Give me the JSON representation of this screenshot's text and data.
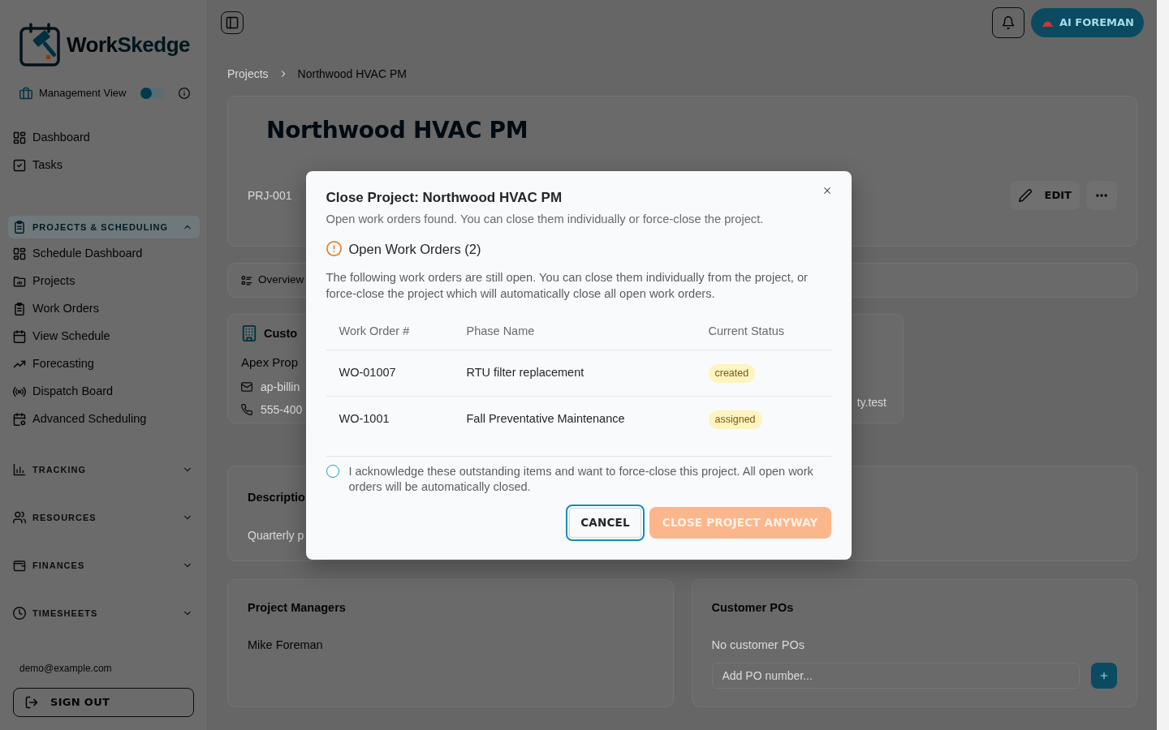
{
  "brand": {
    "first": "Work",
    "second": "Skedge"
  },
  "view_toggle": {
    "label": "Management View",
    "on": false
  },
  "sidebar": {
    "items": [
      {
        "label": "Dashboard",
        "selected": false
      },
      {
        "label": "Tasks",
        "selected": false
      }
    ],
    "sections": [
      {
        "label": "PROJECTS & SCHEDULING",
        "expanded": true,
        "items": [
          {
            "label": "Schedule Dashboard",
            "selected": false
          },
          {
            "label": "Projects",
            "selected": false
          },
          {
            "label": "Work Orders",
            "selected": false
          },
          {
            "label": "View Schedule",
            "selected": false
          },
          {
            "label": "Forecasting",
            "selected": false
          },
          {
            "label": "Dispatch Board",
            "selected": false
          },
          {
            "label": "Advanced Scheduling",
            "selected": false
          }
        ]
      },
      {
        "label": "TRACKING",
        "expanded": false
      },
      {
        "label": "RESOURCES",
        "expanded": false
      },
      {
        "label": "FINANCES",
        "expanded": false
      },
      {
        "label": "TIMESHEETS",
        "expanded": false
      }
    ],
    "user_email": "demo@example.com",
    "sign_out": "SIGN OUT"
  },
  "header": {
    "ai_button": "AI FOREMAN"
  },
  "breadcrumb": [
    {
      "label": "Projects",
      "current": false
    },
    {
      "label": "Northwood HVAC PM",
      "current": true
    }
  ],
  "project": {
    "title": "Northwood HVAC PM",
    "id": "PRJ-001",
    "edit_button": "EDIT"
  },
  "tabs": [
    {
      "label": "Overview",
      "selected": true
    }
  ],
  "customer": {
    "heading": "Custo",
    "name": "Apex Prop",
    "email": "ap-billin",
    "phone": "555-400"
  },
  "contact": {
    "text": "ty.test"
  },
  "description": {
    "heading": "Descriptio",
    "text": "Quarterly p"
  },
  "project_managers": {
    "heading": "Project Managers",
    "names": [
      "Mike Foreman"
    ]
  },
  "customer_pos": {
    "heading": "Customer POs",
    "empty_text": "No customer POs",
    "input": {
      "placeholder": "Add PO number..."
    }
  },
  "dialog": {
    "title": "Close Project: Northwood HVAC PM",
    "subtitle": "Open work orders found. You can close them individually or force-close the project.",
    "warning": {
      "heading": "Open Work Orders (2)",
      "text": "The following work orders are still open. You can close them individually from the project, or force-close the project which will automatically close all open work orders."
    },
    "table": {
      "columns": [
        "Work Order #",
        "Phase Name",
        "Current Status"
      ],
      "rows": [
        {
          "work_order": "WO-01007",
          "phase_name": "RTU filter replacement",
          "current_status": "created"
        },
        {
          "work_order": "WO-1001",
          "phase_name": "Fall Preventative Maintenance",
          "current_status": "assigned"
        }
      ]
    },
    "acknowledge": {
      "label": "I acknowledge these outstanding items and want to force-close this project. All open work orders will be automatically closed.",
      "checked": false
    },
    "buttons": [
      {
        "label": "CANCEL",
        "kind": "secondary",
        "focused": true,
        "disabled": false
      },
      {
        "label": "CLOSE PROJECT ANYWAY",
        "kind": "primary",
        "focused": false,
        "disabled": true
      }
    ]
  }
}
